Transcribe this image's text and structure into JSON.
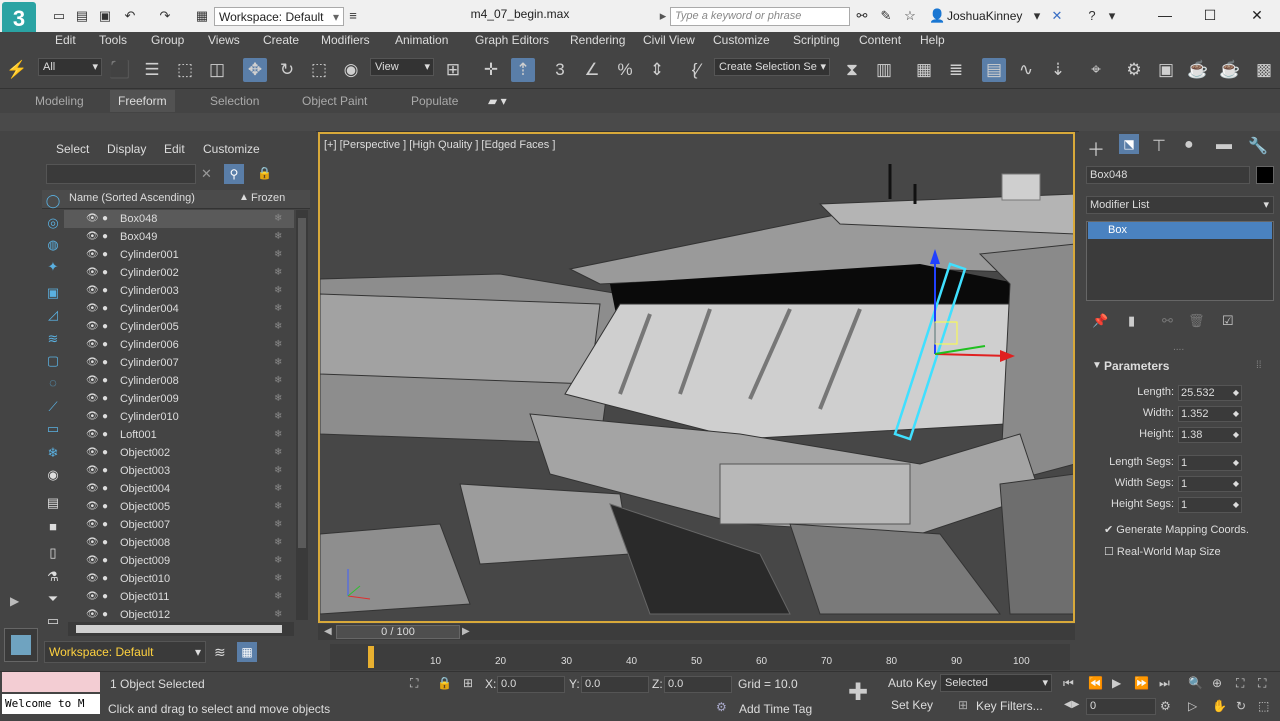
{
  "title_bar": {
    "workspace": "Workspace: Default",
    "document": "m4_07_begin.max",
    "search_placeholder": "Type a keyword or phrase",
    "user": "JoshuaKinney"
  },
  "menu": [
    "Edit",
    "Tools",
    "Group",
    "Views",
    "Create",
    "Modifiers",
    "Animation",
    "Graph Editors",
    "Rendering",
    "Civil View",
    "Customize",
    "Scripting",
    "Content",
    "Help"
  ],
  "toolbar": {
    "filter": "All",
    "ref_coord": "View",
    "selection_set": "Create Selection Se"
  },
  "ribbon_tabs": [
    "Modeling",
    "Freeform",
    "Selection",
    "Object Paint",
    "Populate"
  ],
  "scene_explorer": {
    "tabs": [
      "Select",
      "Display",
      "Edit",
      "Customize"
    ],
    "col_name": "Name (Sorted Ascending)",
    "col_frozen": "Frozen",
    "items": [
      "Box048",
      "Box049",
      "Cylinder001",
      "Cylinder002",
      "Cylinder003",
      "Cylinder004",
      "Cylinder005",
      "Cylinder006",
      "Cylinder007",
      "Cylinder008",
      "Cylinder009",
      "Cylinder010",
      "Loft001",
      "Object002",
      "Object003",
      "Object004",
      "Object005",
      "Object007",
      "Object008",
      "Object009",
      "Object010",
      "Object011",
      "Object012"
    ],
    "workspace": "Workspace: Default"
  },
  "viewport": {
    "label": "[+] [Perspective ] [High Quality ] [Edged Faces ]"
  },
  "command_panel": {
    "object_name": "Box048",
    "modifier_list": "Modifier List",
    "modifier": "Box",
    "rollout": "Parameters",
    "params": [
      {
        "label": "Length:",
        "value": "25.532"
      },
      {
        "label": "Width:",
        "value": "1.352"
      },
      {
        "label": "Height:",
        "value": "1.38"
      }
    ],
    "segs": [
      {
        "label": "Length Segs:",
        "value": "1"
      },
      {
        "label": "Width Segs:",
        "value": "1"
      },
      {
        "label": "Height Segs:",
        "value": "1"
      }
    ],
    "gen_mapping": "Generate Mapping Coords.",
    "real_world": "Real-World Map Size"
  },
  "timeline": {
    "frame": "0 / 100",
    "ticks": [
      "10",
      "20",
      "30",
      "40",
      "50",
      "60",
      "70",
      "80",
      "90",
      "100"
    ]
  },
  "status": {
    "selected": "1 Object Selected",
    "prompt": "Click and drag to select and move objects",
    "maxscript": "Welcome to M",
    "x": "0.0",
    "y": "0.0",
    "z": "0.0",
    "x_label": "X:",
    "y_label": "Y:",
    "z_label": "Z:",
    "grid": "Grid = 10.0",
    "add_time_tag": "Add Time Tag",
    "auto_key": "Auto Key",
    "set_key": "Set Key",
    "key_mode": "Selected",
    "key_filters": "Key Filters...",
    "current_frame": "0"
  }
}
